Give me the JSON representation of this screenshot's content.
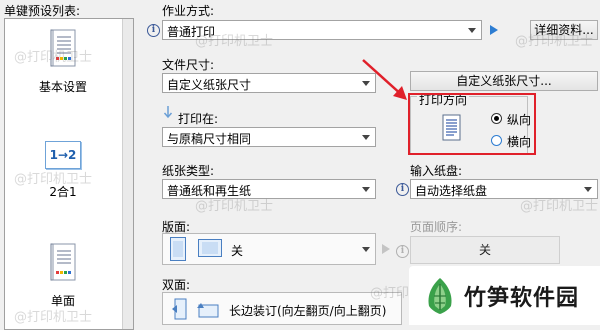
{
  "preset_list": {
    "title": "单键预设列表:",
    "items": [
      {
        "label": "基本设置"
      },
      {
        "label": "2合1",
        "icon_text": "1→2"
      },
      {
        "label": "单面"
      }
    ]
  },
  "job_type": {
    "label": "作业方式:",
    "value": "普通打印",
    "details_button": "详细资料..."
  },
  "paper_size": {
    "label": "文件尺寸:",
    "value": "自定义纸张尺寸",
    "custom_button": "自定义纸张尺寸..."
  },
  "print_on": {
    "label": "打印在:",
    "value": "与原稿尺寸相同"
  },
  "orientation": {
    "title": "打印方向",
    "portrait": "纵向",
    "landscape": "横向",
    "selected": "portrait"
  },
  "paper_type": {
    "label": "纸张类型:",
    "value": "普通纸和再生纸"
  },
  "input_tray": {
    "label": "输入纸盘:",
    "value": "自动选择纸盘"
  },
  "layout": {
    "label": "版面:",
    "value": "关"
  },
  "page_order": {
    "label": "页面顺序:",
    "value": "关"
  },
  "duplex": {
    "label": "双面:",
    "value": "长边装订(向左翻页/向上翻页)"
  },
  "watermark_text": "@打印机卫士",
  "brand": {
    "text": "竹笋软件园"
  },
  "colors": {
    "highlight": "#e0202a",
    "accent": "#2d7dd2",
    "brand_green": "#3aa14a"
  }
}
